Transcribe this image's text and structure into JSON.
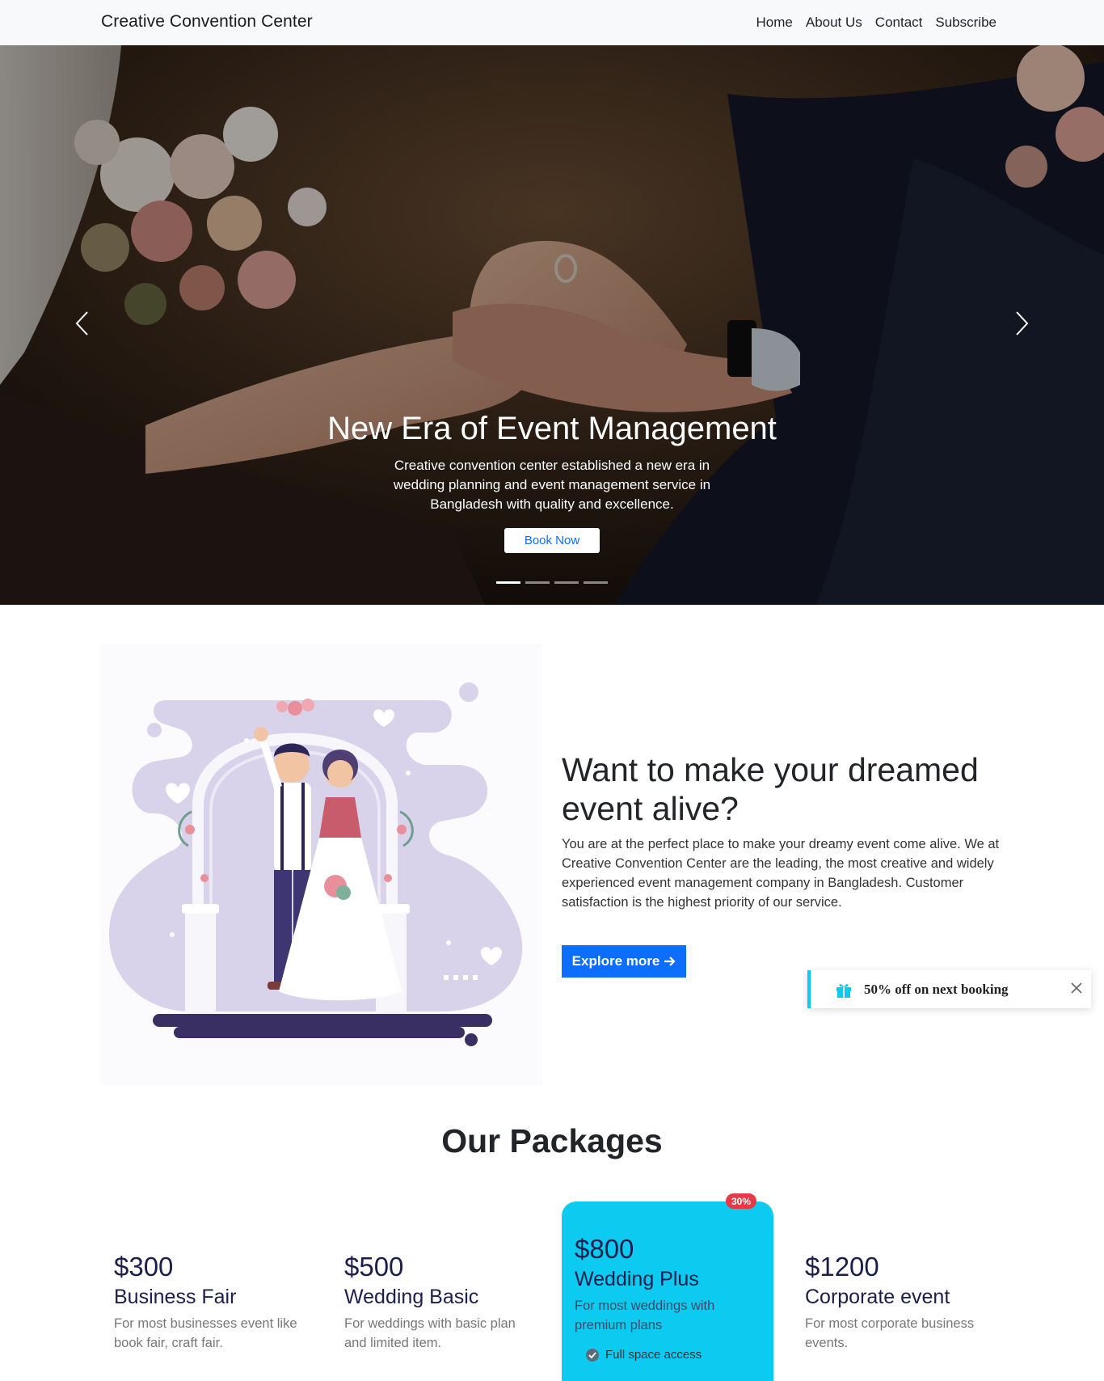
{
  "navbar": {
    "brand": "Creative Convention Center",
    "links": [
      "Home",
      "About Us",
      "Contact",
      "Subscribe"
    ]
  },
  "hero": {
    "title": "New Era of Event Management",
    "text": "Creative convention center established a new era in wedding planning and event management service in Bangladesh with quality and excellence.",
    "button": "Book Now",
    "active_slide": 1,
    "slide_count": 4
  },
  "about": {
    "heading": "Want to make your dreamed event alive?",
    "text": "You are at the perfect place to make your dreamy event come alive. We at Creative Convention Center are the leading, the most creative and widely experienced event management company in Bangladesh. Customer satisfaction is the highest priority of our service.",
    "button": "Explore more"
  },
  "toast": {
    "text": "50% off on next booking",
    "icon": "gift-icon"
  },
  "packages": {
    "title": "Our Packages",
    "items": [
      {
        "price": "$300",
        "name": "Business Fair",
        "desc": "For most businesses event like book fair, craft fair."
      },
      {
        "price": "$500",
        "name": "Wedding Basic",
        "desc": "For weddings with basic plan and limited item."
      },
      {
        "price": "$800",
        "name": "Wedding Plus",
        "desc": "For most weddings with premium plans",
        "badge": "30%",
        "feature": "Full space access"
      },
      {
        "price": "$1200",
        "name": "Corporate event",
        "desc": "For most corporate business events."
      }
    ]
  },
  "colors": {
    "primary": "#0d6efd",
    "accent": "#0dcaf0",
    "badge": "#e63946",
    "heading": "#1b1f4b"
  }
}
